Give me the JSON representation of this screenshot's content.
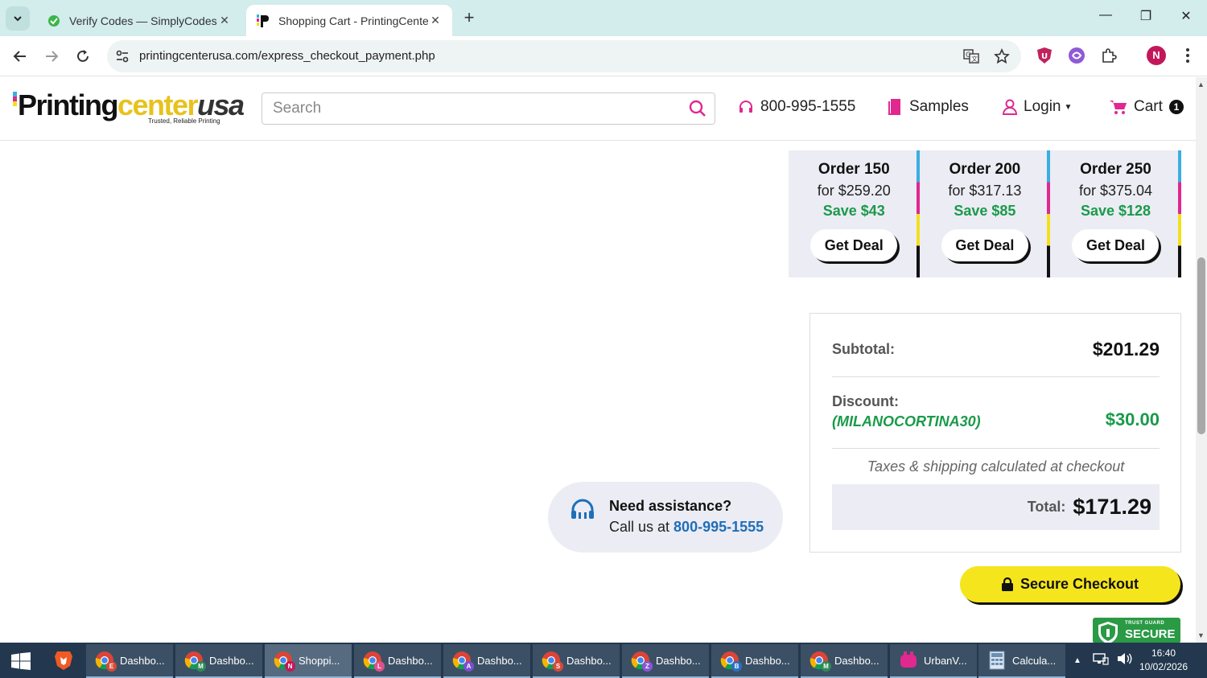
{
  "browser": {
    "tabs": [
      {
        "title": "Verify Codes — SimplyCodes",
        "active": false
      },
      {
        "title": "Shopping Cart - PrintingCenterU",
        "active": true
      }
    ],
    "url": "printingcenterusa.com/express_checkout_payment.php",
    "profile_initial": "N"
  },
  "header": {
    "logo_part1": "Printing",
    "logo_part2": "center",
    "logo_part3": "usa",
    "logo_tagline": "Trusted, Reliable Printing",
    "search_placeholder": "Search",
    "phone": "800-995-1555",
    "samples": "Samples",
    "login": "Login",
    "cart": "Cart",
    "cart_count": "1"
  },
  "deals": [
    {
      "order": "Order 150",
      "price": "for $259.20",
      "save": "Save $43",
      "button": "Get Deal"
    },
    {
      "order": "Order 200",
      "price": "for $317.13",
      "save": "Save $85",
      "button": "Get Deal"
    },
    {
      "order": "Order 250",
      "price": "for $375.04",
      "save": "Save $128",
      "button": "Get Deal"
    }
  ],
  "summary": {
    "subtotal_label": "Subtotal:",
    "subtotal_value": "$201.29",
    "discount_label": "Discount:",
    "discount_code": "(MILANOCORTINA30)",
    "discount_value": "$30.00",
    "taxes_note": "Taxes & shipping calculated at checkout",
    "total_label": "Total:",
    "total_value": "$171.29"
  },
  "assistance": {
    "heading": "Need assistance?",
    "call_text": "Call us at ",
    "phone": "800-995-1555"
  },
  "checkout": {
    "button": "Secure Checkout",
    "trust_small": "TRUST GUARD",
    "trust_big": "SECURE"
  },
  "taskbar": {
    "items": [
      {
        "label": "Dashbo...",
        "badge": "E",
        "badge_color": "#d84a3a"
      },
      {
        "label": "Dashbo...",
        "badge": "M",
        "badge_color": "#2e8b57"
      },
      {
        "label": "Shoppi...",
        "badge": "N",
        "badge_color": "#c2185b"
      },
      {
        "label": "Dashbo...",
        "badge": "L",
        "badge_color": "#e0508a"
      },
      {
        "label": "Dashbo...",
        "badge": "A",
        "badge_color": "#7b4fcf"
      },
      {
        "label": "Dashbo...",
        "badge": "S",
        "badge_color": "#d84a3a"
      },
      {
        "label": "Dashbo...",
        "badge": "Z",
        "badge_color": "#8a56d6"
      },
      {
        "label": "Dashbo...",
        "badge": "B",
        "badge_color": "#2d6fc2"
      },
      {
        "label": "Dashbo...",
        "badge": "M",
        "badge_color": "#2e8b57"
      },
      {
        "label": "UrbanV...",
        "badge": "",
        "badge_color": "#e0288f"
      },
      {
        "label": "Calcula...",
        "badge": "",
        "badge_color": "#6c8fb3"
      }
    ],
    "time": "16:40",
    "date": "10/02/2026"
  },
  "colors": {
    "accent_green": "#1a9a4a",
    "checkout_yellow": "#f5e51d",
    "link_blue": "#1f6fb8",
    "brand_magenta": "#e0288f"
  }
}
